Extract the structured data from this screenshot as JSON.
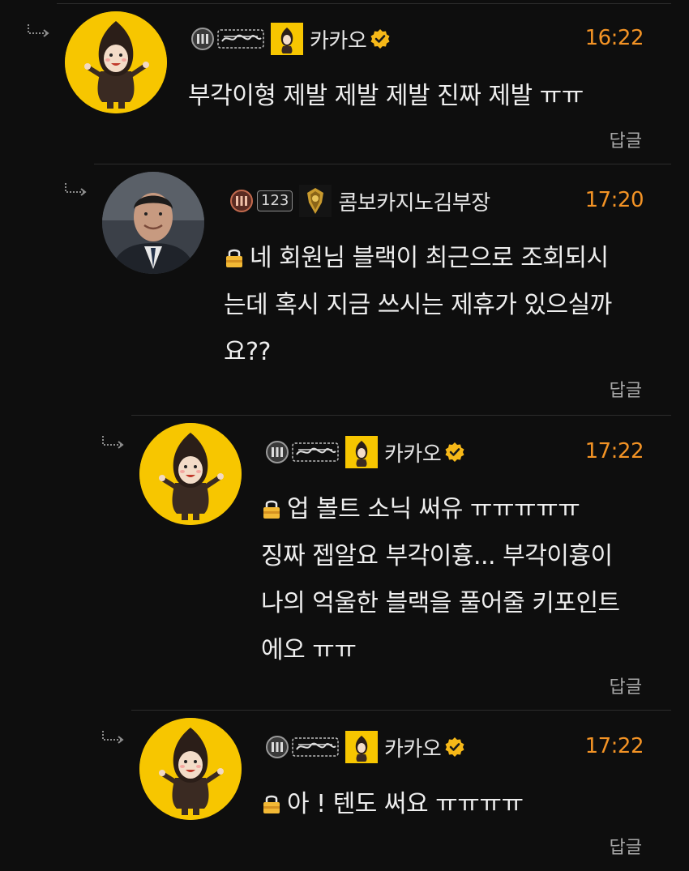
{
  "comments": [
    {
      "username": "카카오",
      "time": "16:22",
      "lines": [
        "부각이형 제발 제발 제발 진짜 제발 ㅠㅠ"
      ],
      "secret": false,
      "reply_label": "답글",
      "verified": true,
      "avatar": "kakao-character"
    },
    {
      "username": "콤보카지노김부장",
      "level": "123",
      "time": "17:20",
      "lines": [
        "네 회원님 블랙이 최근으로 조회되시",
        "는데 혹시 지금 쓰시는 제휴가 있으실까",
        "요??"
      ],
      "secret": true,
      "reply_label": "답글",
      "verified": false,
      "avatar": "man-in-suit-photo"
    },
    {
      "username": "카카오",
      "time": "17:22",
      "lines": [
        "업 볼트 소닉 써유 ㅠㅠㅠㅠㅠ",
        "징짜 젭알요 부각이흉... 부각이흉이",
        "나의 억울한 블랙을 풀어줄 키포인트",
        "에오 ㅠㅠ"
      ],
      "secret": true,
      "reply_label": "답글",
      "verified": true,
      "avatar": "kakao-character"
    },
    {
      "username": "카카오",
      "time": "17:22",
      "lines": [
        "아 ! 텐도 써요 ㅠㅠㅠㅠ"
      ],
      "secret": true,
      "reply_label": "답글",
      "verified": true,
      "avatar": "kakao-character"
    }
  ],
  "colors": {
    "background": "#0e0e0e",
    "time": "#f39325",
    "verified_badge": "#f6b818",
    "avatar_yellow": "#f7c600"
  }
}
